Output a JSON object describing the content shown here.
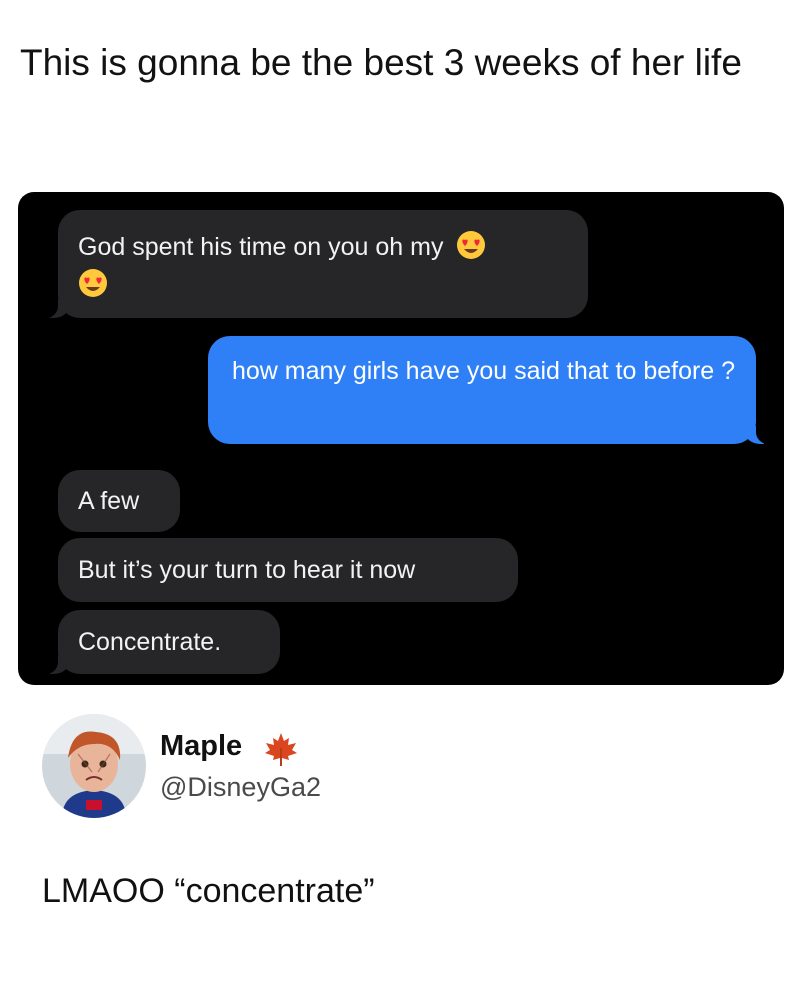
{
  "post": {
    "title": "This is gonna be the best 3 weeks of her life"
  },
  "messages": [
    {
      "direction": "incoming",
      "text": "God spent his time on you oh my"
    },
    {
      "direction": "outgoing",
      "text": "how many girls have you said that to before ?"
    },
    {
      "direction": "incoming",
      "text": "A few"
    },
    {
      "direction": "incoming",
      "text": "But it’s your turn to hear it now"
    },
    {
      "direction": "incoming",
      "text": "Concentrate."
    }
  ],
  "emoji": {
    "name": "heart-eyes-face",
    "colors": {
      "face": "#ffc93b",
      "heart": "#f0263a"
    }
  },
  "tweet": {
    "author_name": "Maple",
    "author_badge_icon": "maple-leaf-icon",
    "author_handle": "@DisneyGa2",
    "text": "LMAOO “concentrate”"
  },
  "colors": {
    "incoming_bubble": "#262628",
    "outgoing_bubble": "#2f80f6",
    "chat_background": "#000000"
  }
}
